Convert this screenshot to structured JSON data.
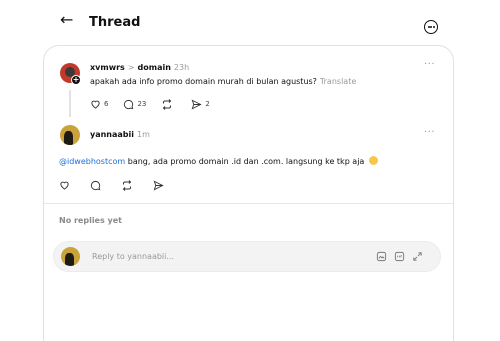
{
  "header": {
    "title": "Thread"
  },
  "post1": {
    "username": "xvmwrs",
    "separator": ">",
    "reply_to": "domain",
    "time": "23h",
    "text": "apakah ada info promo domain murah di bulan agustus?",
    "translate": "Translate",
    "likes": "6",
    "comments": "23",
    "reposts": "",
    "shares": "2"
  },
  "post2": {
    "username": "yannaabii",
    "time": "1m",
    "mention": "@idwebhostcom",
    "text": " bang, ada promo domain .id dan .com. langsung ke tkp aja "
  },
  "replies": {
    "empty_label": "No replies yet"
  },
  "reply_box": {
    "placeholder": "Reply to yannaabii..."
  },
  "icons": {
    "back": "arrow-left-icon",
    "more": "more-circle-icon",
    "like": "heart-icon",
    "comment": "comment-icon",
    "repost": "repost-icon",
    "share": "send-icon",
    "gallery": "image-icon",
    "gif": "gif-icon",
    "expand": "expand-icon"
  },
  "colors": {
    "mention": "#1d6fd6",
    "muted": "#999999"
  }
}
